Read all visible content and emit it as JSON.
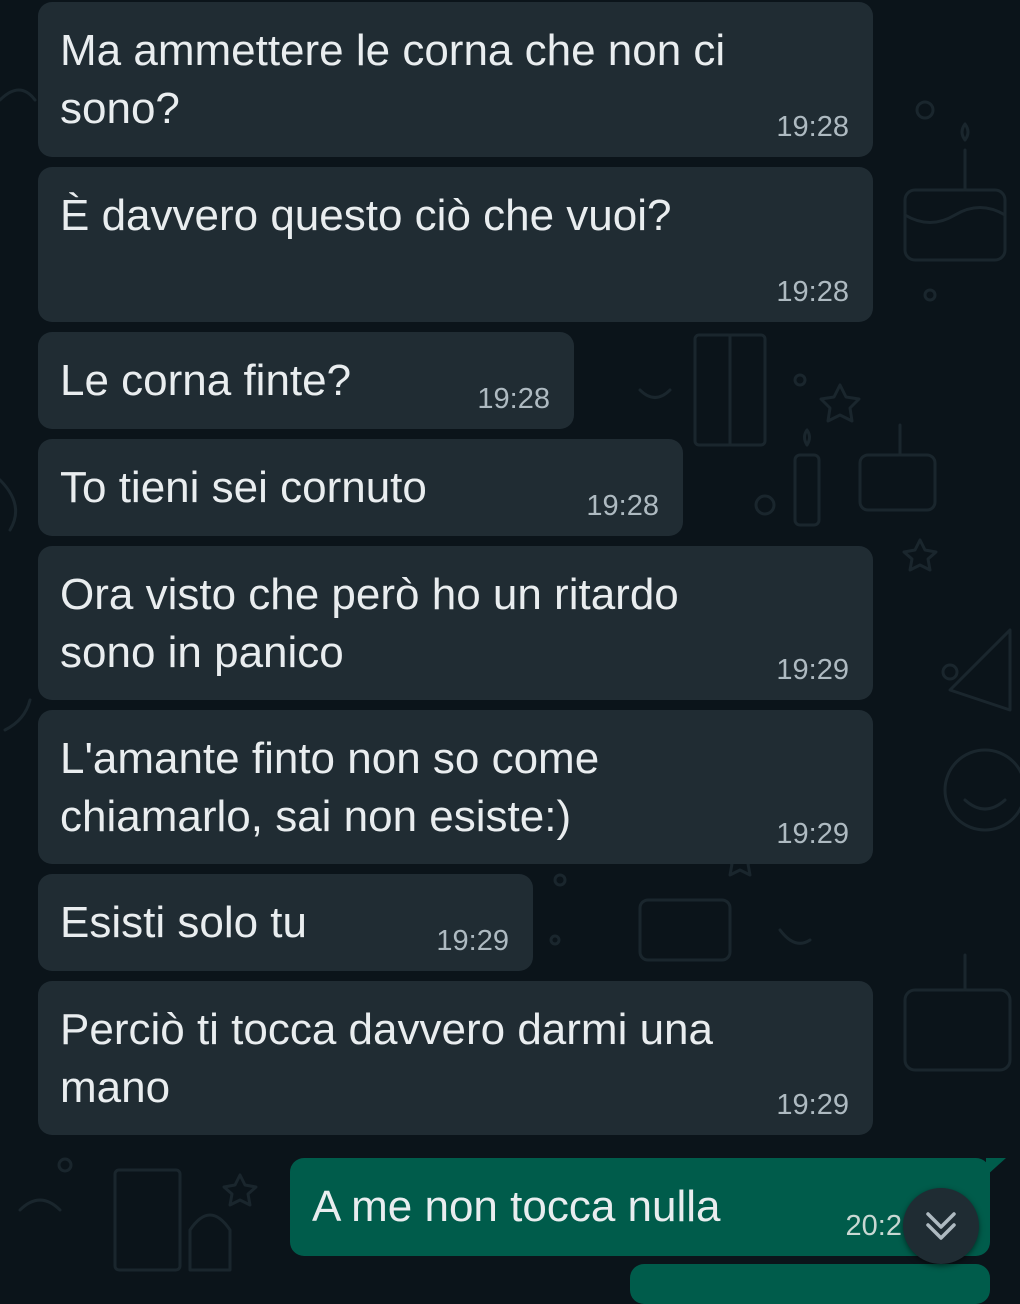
{
  "colors": {
    "background": "#0b141a",
    "incoming_bubble": "#202c33",
    "outgoing_bubble": "#005c4b",
    "text": "#e9edef",
    "timestamp": "#aebac1"
  },
  "messages": [
    {
      "text": "Ma ammettere le corna che non ci\nsono?",
      "time": "19:28",
      "direction": "incoming"
    },
    {
      "text": "È davvero questo ciò che vuoi?",
      "time": "19:28",
      "direction": "incoming"
    },
    {
      "text": "Le corna finte?",
      "time": "19:28",
      "direction": "incoming"
    },
    {
      "text": "To tieni sei cornuto",
      "time": "19:28",
      "direction": "incoming"
    },
    {
      "text": "Ora visto che però ho un ritardo\nsono in panico",
      "time": "19:29",
      "direction": "incoming"
    },
    {
      "text": "L'amante finto non so come\nchiamarlo, sai non esiste:)",
      "time": "19:29",
      "direction": "incoming"
    },
    {
      "text": "Esisti solo tu",
      "time": "19:29",
      "direction": "incoming"
    },
    {
      "text": "Perciò ti tocca davvero darmi una\nmano",
      "time": "19:29",
      "direction": "incoming"
    },
    {
      "text": "A me non tocca nulla",
      "time": "20:2",
      "direction": "outgoing"
    }
  ],
  "scroll_button": {
    "icon": "double-chevron-down-icon"
  }
}
